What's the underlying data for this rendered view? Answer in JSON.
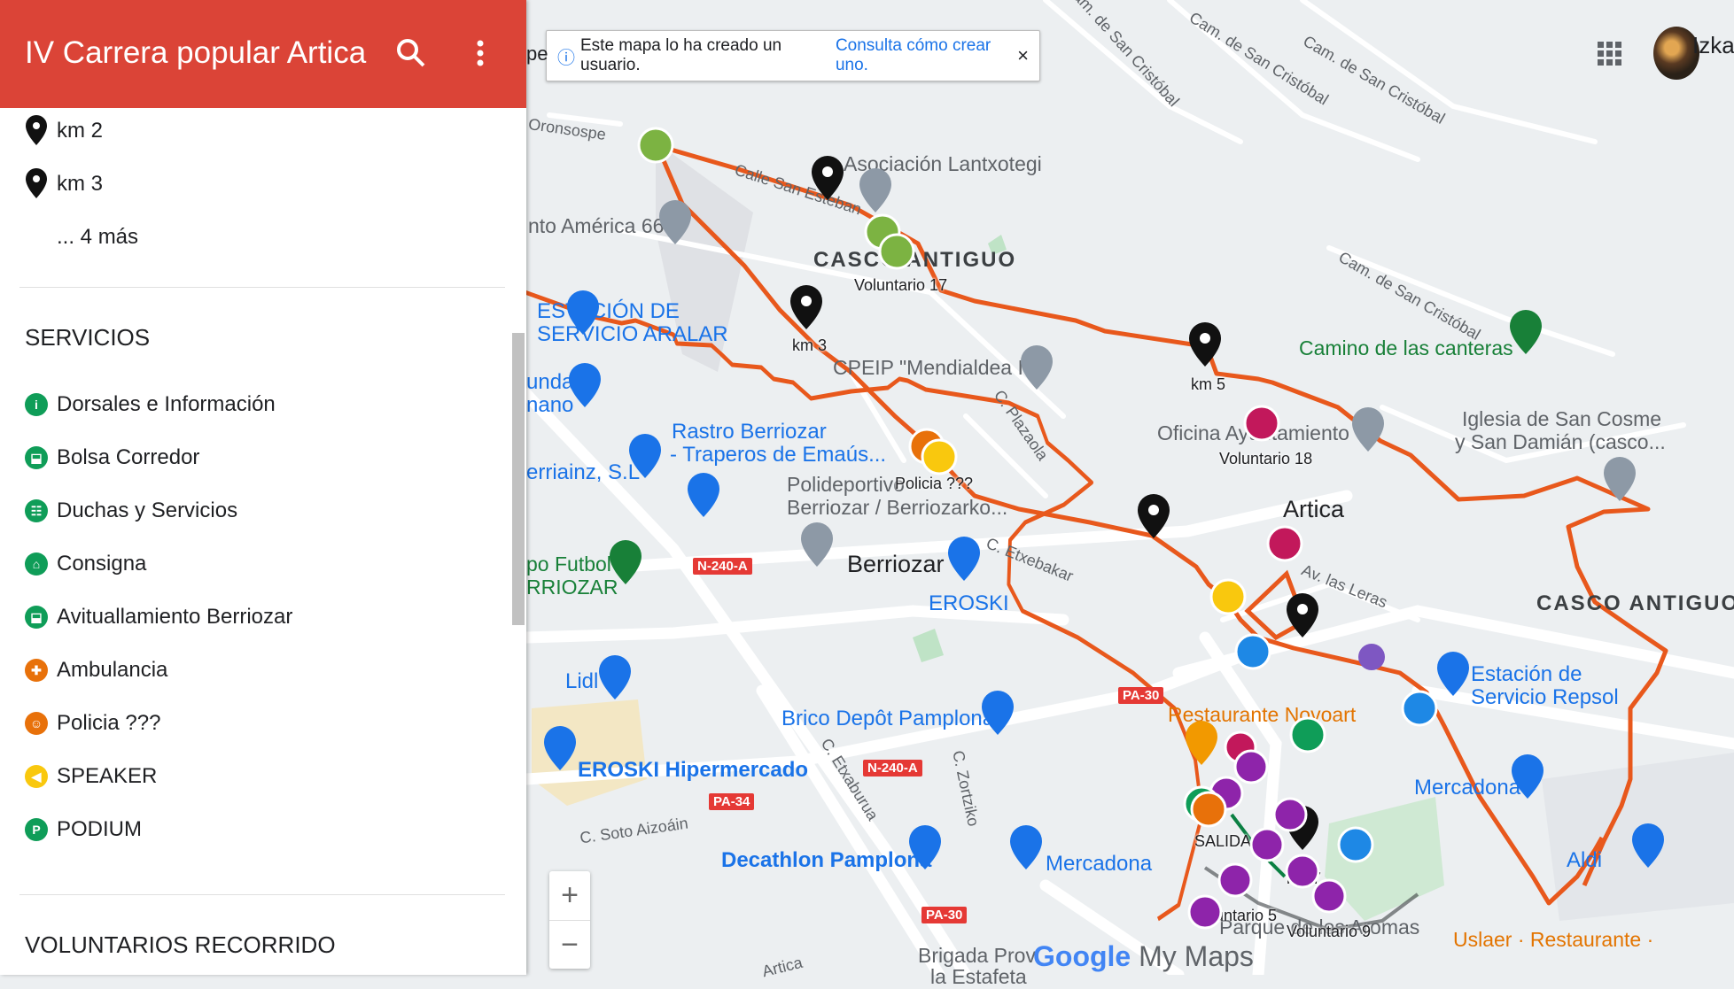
{
  "panel": {
    "title": "IV Carrera popular Artica",
    "header_color": "#db4437",
    "icons": [
      "search-icon",
      "more-vert-icon"
    ],
    "km_items": [
      {
        "label": "km 2",
        "icon": "pin-icon"
      },
      {
        "label": "km 3",
        "icon": "pin-icon"
      }
    ],
    "more_label": "... 4 más",
    "services_title": "SERVICIOS",
    "services": [
      {
        "label": "Dorsales e Información",
        "color": "#0f9d58",
        "glyph": "i"
      },
      {
        "label": "Bolsa Corredor",
        "color": "#0f9d58",
        "glyph": "⬓"
      },
      {
        "label": "Duchas y Servicios",
        "color": "#0f9d58",
        "glyph": "☷"
      },
      {
        "label": "Consigna",
        "color": "#0f9d58",
        "glyph": "⌂"
      },
      {
        "label": "Avituallamiento Berriozar",
        "color": "#0f9d58",
        "glyph": "⬓"
      },
      {
        "label": "Ambulancia",
        "color": "#e8710a",
        "glyph": "✚"
      },
      {
        "label": "Policia ???",
        "color": "#e8710a",
        "glyph": "☺"
      },
      {
        "label": "SPEAKER",
        "color": "#f9c80e",
        "glyph": "◀"
      },
      {
        "label": "PODIUM",
        "color": "#0f9d58",
        "glyph": "P"
      }
    ],
    "volunteers_title": "VOLUNTARIOS RECORRIDO"
  },
  "banner": {
    "text": "Este mapa lo ha creado un usuario.",
    "link": "Consulta cómo crear uno.",
    "close": "×",
    "left_fragment": "pe"
  },
  "user": {
    "name": "Izkal"
  },
  "zoom": {
    "in": "+",
    "out": "−"
  },
  "brand": {
    "google": "Google",
    "product": "My Maps"
  },
  "route_color": "#e8581c",
  "map": {
    "areas": [
      "CASCO ANTIGUO",
      "CASCO ANTIGUO"
    ],
    "towns": [
      "Artica",
      "Berriozar"
    ],
    "streets": [
      "Cam. de San Cristóbal",
      "Cam. de San Cristóbal",
      "Cam. de San Cristóbal",
      "Cam. de San Cristóbal",
      "Calle San Esteban",
      "C. Plazaola",
      "C. Etxebakar",
      "Av. las Leras",
      "C. Etxaburua",
      "C. Zortziko",
      "C. Soto Aizoáin",
      "Oronsospe",
      "Artica"
    ],
    "roads": [
      "N-240-A",
      "N-240-A",
      "PA-30",
      "PA-30",
      "PA-34"
    ],
    "pois": [
      {
        "name": "Asociación Lantxotegi",
        "kind": "gray"
      },
      {
        "name": "nto América 66",
        "kind": "gray"
      },
      {
        "name": "ESTACIÓN DE",
        "kind": "blue"
      },
      {
        "name": "SERVICIO ARALAR",
        "kind": "blue"
      },
      {
        "name": "CPEIP \"Mendialdea I\"",
        "kind": "gray"
      },
      {
        "name": "unda",
        "kind": "blue"
      },
      {
        "name": "nano",
        "kind": "blue"
      },
      {
        "name": "Rastro Berriozar",
        "kind": "blue"
      },
      {
        "name": "- Traperos de Emaús...",
        "kind": "blue"
      },
      {
        "name": "erriainz, S.L",
        "kind": "blue"
      },
      {
        "name": "Polideportivo",
        "kind": "gray"
      },
      {
        "name": "Berriozar / Berriozarko...",
        "kind": "gray"
      },
      {
        "name": "po Futbol",
        "kind": "green"
      },
      {
        "name": "RRIOZAR",
        "kind": "green"
      },
      {
        "name": "EROSKI",
        "kind": "blue"
      },
      {
        "name": "Lidl",
        "kind": "blue"
      },
      {
        "name": "Brico Depôt Pamplona",
        "kind": "blue"
      },
      {
        "name": "EROSKI Hipermercado",
        "kind": "blue"
      },
      {
        "name": "Decathlon Pamplona",
        "kind": "blue"
      },
      {
        "name": "Mercadona",
        "kind": "blue"
      },
      {
        "name": "Mercadona",
        "kind": "blue"
      },
      {
        "name": "Aldi",
        "kind": "blue"
      },
      {
        "name": "Camino de las canteras",
        "kind": "green"
      },
      {
        "name": "Oficina Ayuntamiento",
        "kind": "gray"
      },
      {
        "name": "Iglesia de San Cosme",
        "kind": "gray"
      },
      {
        "name": "y San Damián (casco...",
        "kind": "gray"
      },
      {
        "name": "Estación de",
        "kind": "blue"
      },
      {
        "name": "Servicio Repsol",
        "kind": "blue"
      },
      {
        "name": "Restaurante Novoart",
        "kind": "orange"
      },
      {
        "name": "Uslaer · Restaurante ·",
        "kind": "orange"
      },
      {
        "name": "Brigada Prov",
        "kind": "gray"
      },
      {
        "name": "la Estafeta",
        "kind": "gray"
      },
      {
        "name": "Parque de los Aromas",
        "kind": "gray"
      }
    ],
    "marker_labels": [
      "Voluntario 17",
      "km 3",
      "km 5",
      "Voluntario 18",
      "Policia ???",
      "SALIDA",
      "km 7",
      "Voluntario 5",
      "Voluntario 9"
    ]
  }
}
